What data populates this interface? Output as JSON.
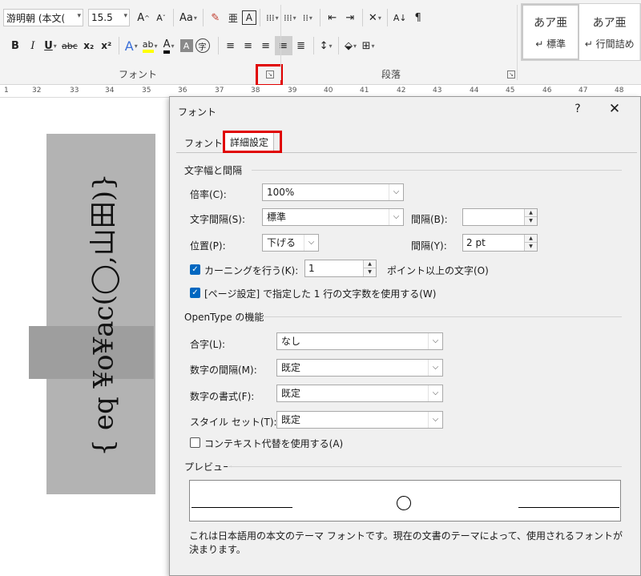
{
  "ribbon": {
    "font_name": "游明朝 (本文(",
    "font_size": "15.5",
    "grow_font": "A",
    "shrink_font": "A",
    "change_case": "Aa",
    "bold": "B",
    "italic": "I",
    "underline": "U",
    "strikethrough": "abc",
    "subscript": "x₂",
    "superscript": "x²",
    "text_effects": "A",
    "highlight": "ab",
    "font_color": "A",
    "char_shading": "A",
    "enclose_char": "字",
    "font_group_label": "フォント",
    "paragraph_group_label": "段落",
    "styles": [
      {
        "sample": "あア亜",
        "name": "↵ 標準"
      },
      {
        "sample": "あア亜",
        "name": "↵ 行間詰め"
      }
    ]
  },
  "ruler": {
    "labels": [
      "1",
      "32",
      "33",
      "34",
      "35",
      "36",
      "37",
      "38",
      "39",
      "40",
      "41",
      "42",
      "43",
      "44",
      "45",
      "46",
      "47",
      "48"
    ]
  },
  "document": {
    "field_text": "{ eq ¥o¥ac(◯,山田)}"
  },
  "dialog": {
    "title": "フォント",
    "help": "?",
    "close": "✕",
    "tabs": {
      "font": "フォント",
      "advanced": "詳細設定"
    },
    "spacing_section": "文字幅と間隔",
    "scale_label": "倍率(C):",
    "scale_value": "100%",
    "spacing_label": "文字間隔(S):",
    "spacing_value": "標準",
    "spacing_by_label": "間隔(B):",
    "spacing_by_value": "",
    "position_label": "位置(P):",
    "position_value": "下げる",
    "position_by_label": "間隔(Y):",
    "position_by_value": "2 pt",
    "kerning_label": "カーニングを行う(K):",
    "kerning_value": "1",
    "kerning_suffix": "ポイント以上の文字(O)",
    "grid_label": "[ページ設定] で指定した 1 行の文字数を使用する(W)",
    "opentype_section": "OpenType の機能",
    "ligatures_label": "合字(L):",
    "ligatures_value": "なし",
    "number_spacing_label": "数字の間隔(M):",
    "number_spacing_value": "既定",
    "number_forms_label": "数字の書式(F):",
    "number_forms_value": "既定",
    "stylistic_sets_label": "スタイル セット(T):",
    "stylistic_sets_value": "既定",
    "contextual_label": "コンテキスト代替を使用する(A)",
    "preview_section": "プレビュー",
    "preview_note": "これは日本語用の本文のテーマ フォントです。現在の文書のテーマによって、使用されるフォントが決まります。"
  }
}
